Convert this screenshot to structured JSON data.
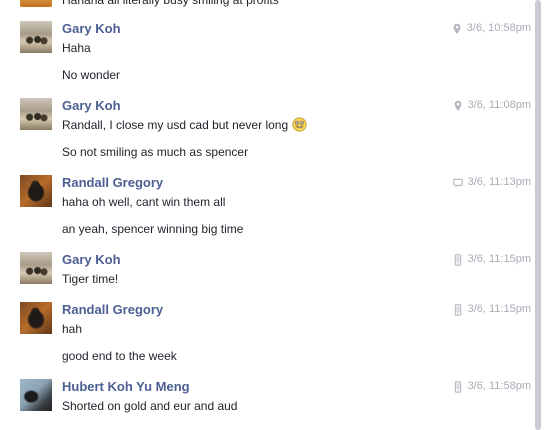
{
  "top_partial_text": "Hahaha all literally busy smiling at profits",
  "groups": [
    {
      "sender": "Gary Koh",
      "avatar": "gary-koh-avatar",
      "source_icon": "location-pin-icon",
      "timestamp": "3/6, 10:58pm",
      "messages": [
        "Haha",
        "No wonder"
      ]
    },
    {
      "sender": "Gary Koh",
      "avatar": "gary-koh-avatar",
      "source_icon": "location-pin-icon",
      "timestamp": "3/6, 11:08pm",
      "messages": [
        "Randall, I close my usd cad but never long",
        "So not smiling as much as spencer"
      ],
      "emoji": "grin-emoji"
    },
    {
      "sender": "Randall Gregory",
      "avatar": "randall-gregory-avatar",
      "source_icon": "chat-bubble-icon",
      "timestamp": "3/6, 11:13pm",
      "messages": [
        "haha oh well, cant win them all",
        "an yeah, spencer winning big time"
      ]
    },
    {
      "sender": "Gary Koh",
      "avatar": "gary-koh-avatar",
      "source_icon": "mobile-phone-icon",
      "timestamp": "3/6, 11:15pm",
      "messages": [
        "Tiger time!"
      ]
    },
    {
      "sender": "Randall Gregory",
      "avatar": "randall-gregory-avatar",
      "source_icon": "mobile-phone-icon",
      "timestamp": "3/6, 11:15pm",
      "messages": [
        "hah",
        "good end to the week"
      ]
    },
    {
      "sender": "Hubert Koh Yu Meng",
      "avatar": "hubert-koh-avatar",
      "source_icon": "mobile-phone-icon",
      "timestamp": "3/6, 11:58pm",
      "messages": [
        "Shorted on gold and eur and aud"
      ]
    }
  ],
  "colors": {
    "name": "#4b5f92",
    "text": "#1d2129",
    "meta": "#a7acb5",
    "scroll_thumb": "#c9cdd3"
  }
}
